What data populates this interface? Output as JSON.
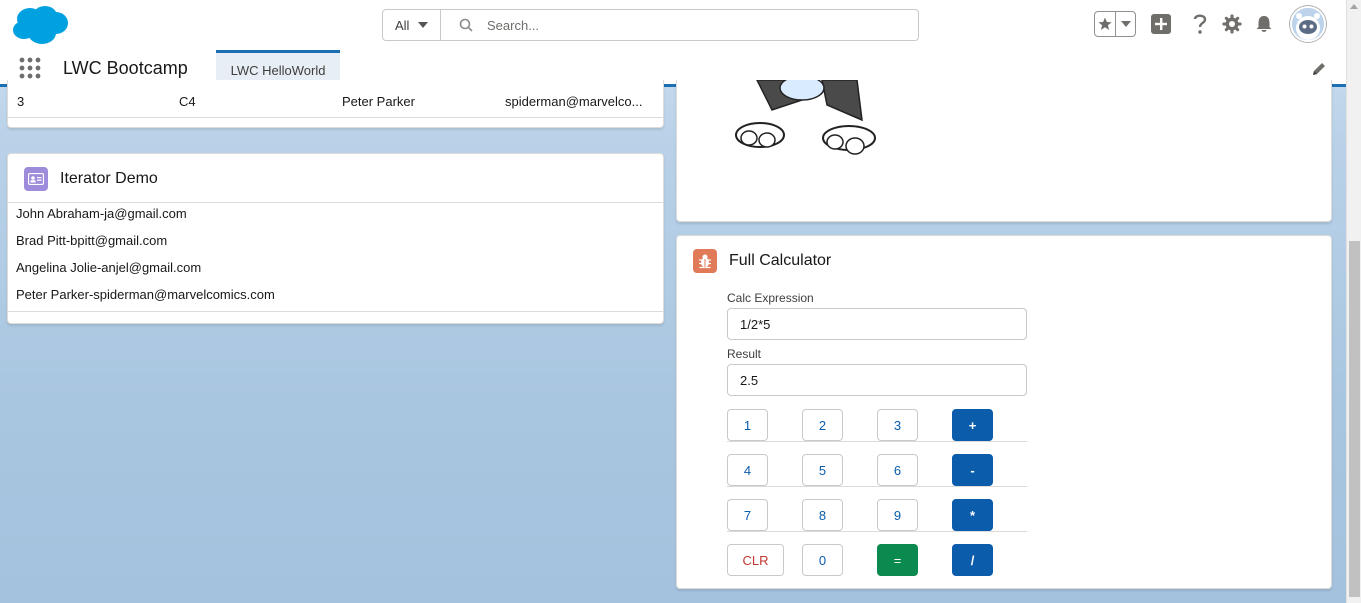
{
  "colors": {
    "brand": "#1b6fb5",
    "operator": "#0b5cab",
    "equals": "#0a8a4e",
    "clear": "#c23934",
    "iterator_icon": "#9e8cdb",
    "calc_icon": "#e07a58"
  },
  "header": {
    "search_scope": "All",
    "search_placeholder": "Search...",
    "icons": [
      "favorites-star-icon",
      "add-icon",
      "help-icon",
      "setup-gear-icon",
      "notifications-bell-icon",
      "user-avatar"
    ]
  },
  "nav": {
    "app_name": "LWC Bootcamp",
    "tabs": [
      {
        "label": "LWC HelloWorld",
        "active": true
      }
    ]
  },
  "contacts_table": {
    "rows": [
      {
        "id": "3",
        "code": "C4",
        "name": "Peter Parker",
        "email": "spiderman@marvelco..."
      }
    ]
  },
  "iterator_demo": {
    "title": "Iterator Demo",
    "items": [
      "John Abraham-ja@gmail.com",
      "Brad Pitt-bpitt@gmail.com",
      "Angelina Jolie-anjel@gmail.com",
      "Peter Parker-spiderman@marvelcomics.com"
    ]
  },
  "calculator": {
    "title": "Full Calculator",
    "expression_label": "Calc Expression",
    "expression_value": "1/2*5",
    "result_label": "Result",
    "result_value": "2.5",
    "keys": {
      "k1": "1",
      "k2": "2",
      "k3": "3",
      "plus": "+",
      "k4": "4",
      "k5": "5",
      "k6": "6",
      "minus": "-",
      "k7": "7",
      "k8": "8",
      "k9": "9",
      "multiply": "*",
      "clear": "CLR",
      "k0": "0",
      "equals": "=",
      "divide": "/"
    }
  }
}
